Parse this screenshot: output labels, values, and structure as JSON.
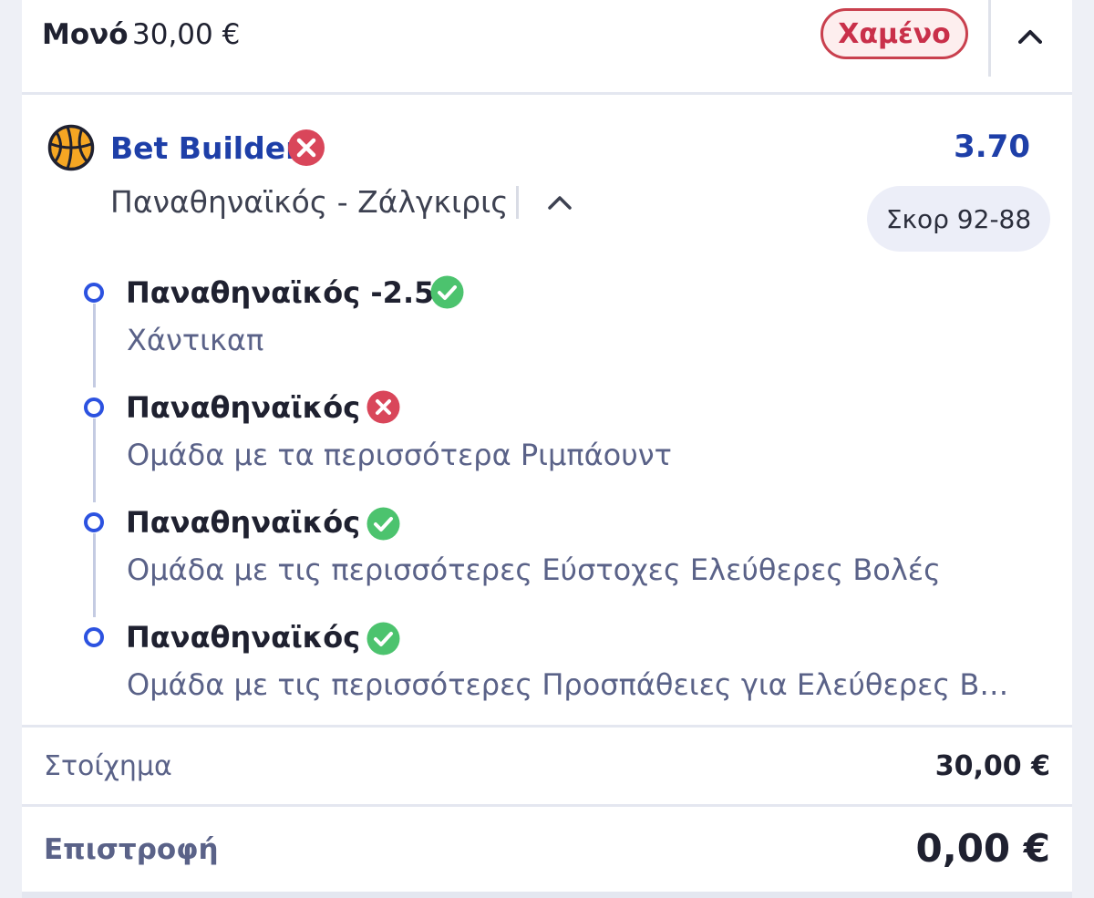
{
  "header": {
    "bet_type": "Μονό",
    "stake": "30,00 €",
    "status": "Χαμένο"
  },
  "selection": {
    "title": "Bet Builder",
    "odds": "3.70",
    "event": "Παναθηναϊκός - Ζάλγκιρις",
    "score": "Σκορ 92-88",
    "sport_icon": "basketball-icon",
    "status_icon": "lost-x-icon"
  },
  "legs": [
    {
      "title": "Παναθηναϊκός -2.5",
      "market": "Χάντικαπ",
      "result": "won"
    },
    {
      "title": "Παναθηναϊκός",
      "market": "Ομάδα με τα περισσότερα Ριμπάουντ",
      "result": "lost"
    },
    {
      "title": "Παναθηναϊκός",
      "market": "Ομάδα με τις περισσότερες Εύστοχες Ελεύθερες Βολές",
      "result": "won"
    },
    {
      "title": "Παναθηναϊκός",
      "market": "Ομάδα με τις περισσότερες Προσπάθειες για Ελεύθερες Β…",
      "result": "won"
    }
  ],
  "summary": {
    "stake_label": "Στοίχημα",
    "stake_value": "30,00 €",
    "return_label": "Επιστροφή",
    "return_value": "0,00 €"
  },
  "colors": {
    "accent_blue": "#1e3fa8",
    "lost_red": "#d9465a",
    "won_green": "#4cc36e"
  }
}
